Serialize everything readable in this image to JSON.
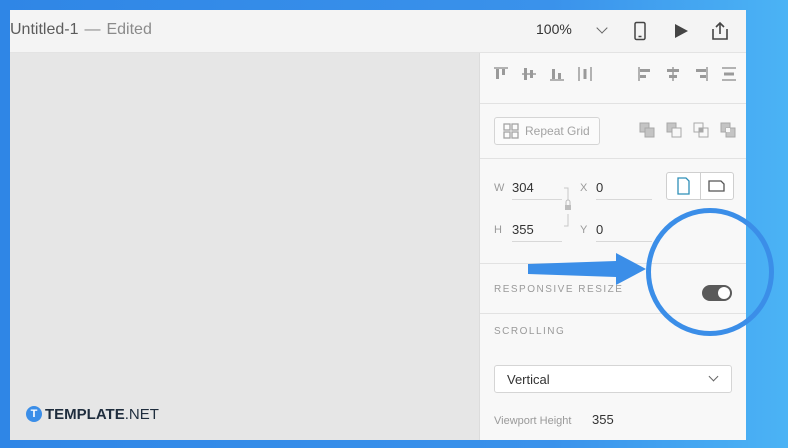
{
  "window": {
    "document_name": "Untitled-1",
    "separator": "—",
    "status": "Edited",
    "zoom": "100%"
  },
  "toolbar_icons": [
    "device-preview-icon",
    "play-icon",
    "share-icon"
  ],
  "inspector": {
    "align_icons": [
      "align-top-icon",
      "align-vertical-center-icon",
      "align-bottom-icon",
      "distribute-vertical-icon",
      "align-left-icon",
      "align-horizontal-center-icon",
      "align-right-icon",
      "distribute-horizontal-icon"
    ],
    "repeat_grid_label": "Repeat Grid",
    "boolean_icons": [
      "add-icon",
      "subtract-icon",
      "intersect-icon",
      "exclude-icon"
    ],
    "size": {
      "w_label": "W",
      "w_value": "304",
      "h_label": "H",
      "h_value": "355",
      "x_label": "X",
      "x_value": "0",
      "y_label": "Y",
      "y_value": "0"
    },
    "responsive_resize_label": "RESPONSIVE RESIZE",
    "responsive_resize_on": true,
    "scrolling_label": "SCROLLING",
    "scrolling_value": "Vertical",
    "viewport_height_label": "Viewport Height",
    "viewport_height_value": "355"
  },
  "annotation": {
    "color": "#3b8ee8"
  },
  "watermark": {
    "logo_letter": "T",
    "brand": "TEMPLATE",
    "suffix": ".NET"
  }
}
